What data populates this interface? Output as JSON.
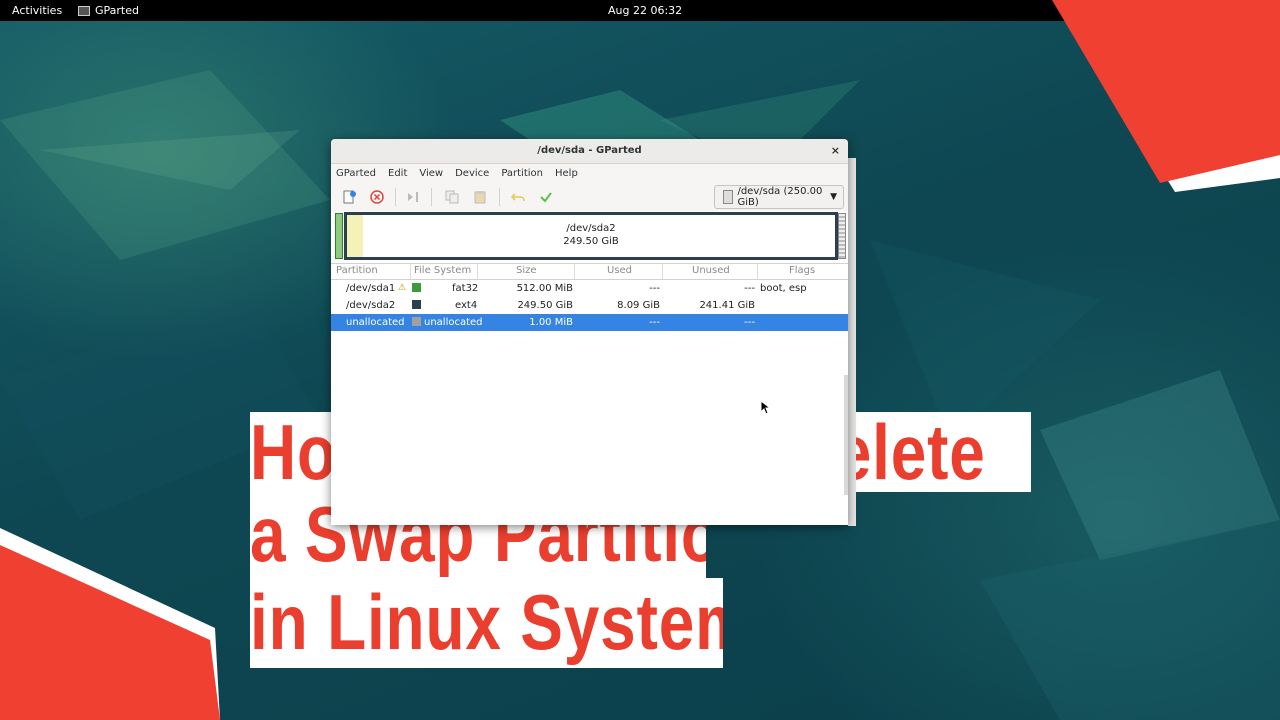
{
  "topbar": {
    "activities": "Activities",
    "app_name": "GParted",
    "clock": "Aug 22  06:32"
  },
  "window": {
    "title": "/dev/sda - GParted",
    "close_glyph": "×",
    "menu": [
      "GParted",
      "Edit",
      "View",
      "Device",
      "Partition",
      "Help"
    ],
    "toolbar_icons": [
      "new-partition-icon",
      "delete-partition-icon",
      "resize-move-icon",
      "copy-icon",
      "paste-icon",
      "undo-icon",
      "apply-icon"
    ],
    "device_select": "/dev/sda (250.00 GiB)",
    "disk_map": {
      "partition_label": "/dev/sda2",
      "partition_size": "249.50 GiB"
    },
    "table": {
      "headers": [
        "Partition",
        "File System",
        "Size",
        "Used",
        "Unused",
        "Flags"
      ],
      "rows": [
        {
          "partition": "/dev/sda1",
          "warning": true,
          "color": "#3d9a3d",
          "filesystem": "fat32",
          "size": "512.00 MiB",
          "used": "---",
          "unused": "---",
          "flags": "boot, esp",
          "selected": false
        },
        {
          "partition": "/dev/sda2",
          "warning": false,
          "color": "#2d3e50",
          "filesystem": "ext4",
          "size": "249.50 GiB",
          "used": "8.09 GiB",
          "unused": "241.41 GiB",
          "flags": "",
          "selected": false
        },
        {
          "partition": "unallocated",
          "warning": false,
          "color": "#a0a0a0",
          "filesystem": "unallocated",
          "size": "1.00 MiB",
          "used": "---",
          "unused": "---",
          "flags": "",
          "selected": true
        }
      ]
    }
  },
  "overlay_title": {
    "line1": "How To Disable / Delete",
    "line2": "a Swap Partition",
    "line3": "in Linux Systems"
  },
  "colors": {
    "accent_red": "#ea3e2e",
    "selection_blue": "#3584e4",
    "desktop_teal": "#0f4a57"
  }
}
